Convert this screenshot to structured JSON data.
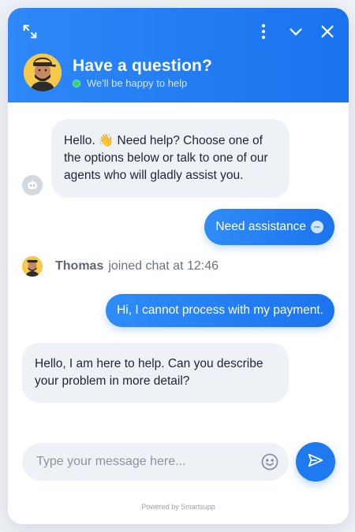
{
  "header": {
    "title": "Have a question?",
    "status": "We'll be happy to help",
    "status_color": "#2ed573",
    "gradient": [
      "#2f88f7",
      "#1a72ee"
    ],
    "icons": [
      "expand-icon",
      "more-vertical-icon",
      "chevron-down-icon",
      "close-icon"
    ]
  },
  "messages": {
    "bot_greeting": "Hello. 👋  Need help? Choose one of the options below or talk to one of our agents who will gladly assist you.",
    "option_chip": "Need assistance",
    "joined": {
      "name": "Thomas",
      "text": "joined chat at 12:46"
    },
    "user_message": "Hi, I cannot process with my payment.",
    "agent_reply": "Hello, I am here to help. Can you describe your problem in more detail?"
  },
  "composer": {
    "placeholder": "Type your message here...",
    "emoji_icon": "smiley-icon",
    "send_icon": "send-icon"
  },
  "footer": {
    "powered_by": "Powered by Smartsupp"
  }
}
